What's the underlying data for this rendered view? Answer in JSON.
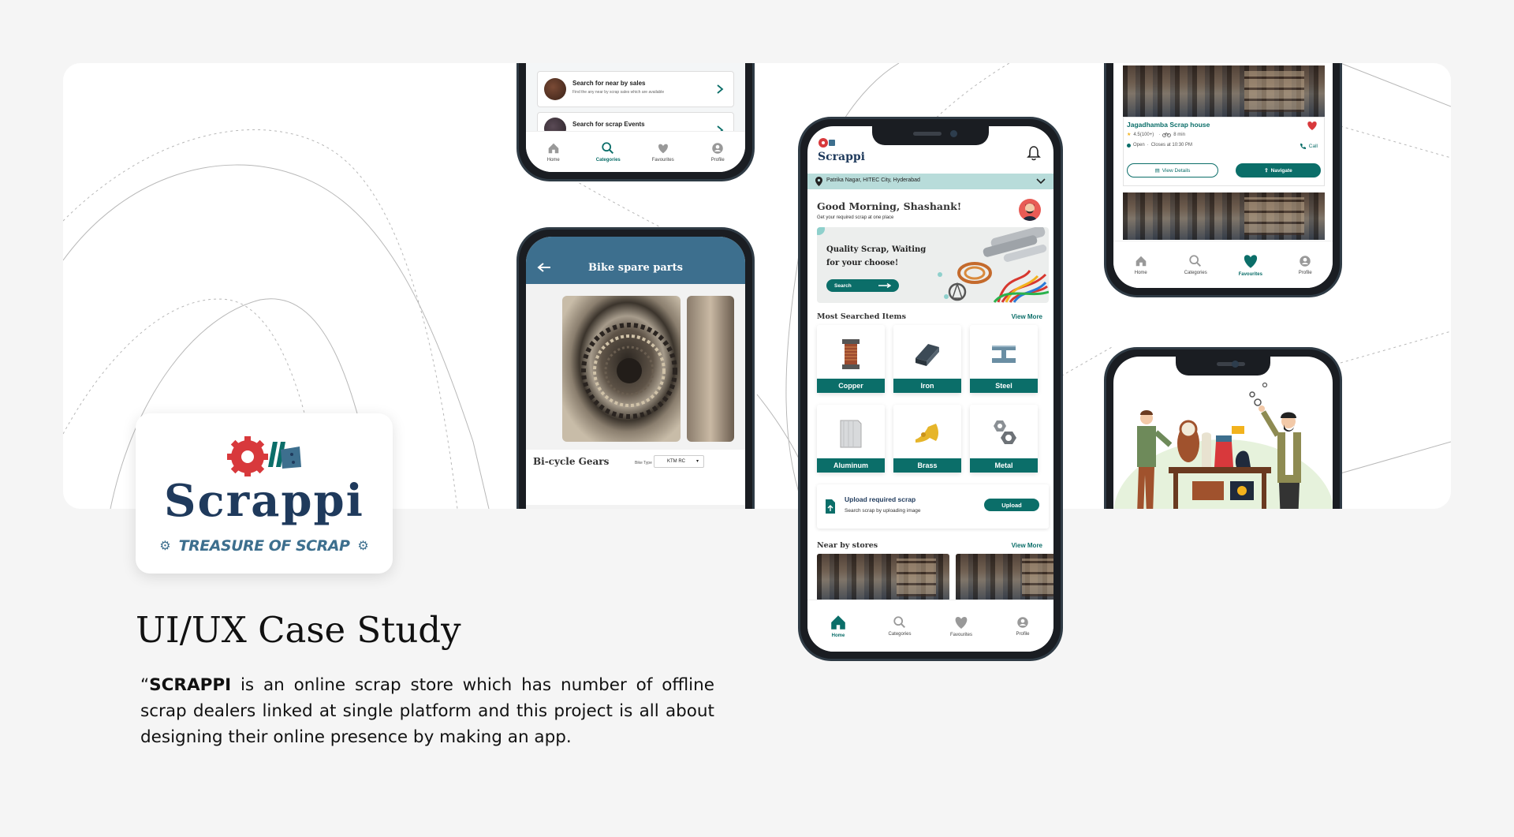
{
  "brand": {
    "name": "Scrappi",
    "tagline": "TREASURE OF SCRAP",
    "colors": {
      "navy": "#1f3a5c",
      "teal": "#0b6e69",
      "red": "#d8393c",
      "steel": "#3d6f8e"
    }
  },
  "case_study": {
    "title": "UI/UX Case Study",
    "quote_mark": "“",
    "strong": "SCRAPPI",
    "desc": " is an online scrap store which has number of offline scrap dealers linked at single platform and this project is all about designing their online presence by making an app."
  },
  "nav": {
    "home": "Home",
    "categories": "Categories",
    "favourites": "Favourites",
    "profile": "Profile"
  },
  "phone_top": {
    "items": [
      {
        "title": "Search for near by sales",
        "sub": "Find the any near by scrap sales which are available"
      },
      {
        "title": "Search for scrap Events",
        "sub": ""
      }
    ]
  },
  "phone_bike": {
    "header": "Bike spare parts",
    "product": "Bi-cycle Gears",
    "filter_label": "Bike Type",
    "filter_value": "KTM RC"
  },
  "phone_main": {
    "logo_text": "Scrappi",
    "location": "Patrika Nagar, HITEC City, Hyderabad",
    "greeting": "Good Morning, Shashank!",
    "greeting_sub": "Get your required scrap at one place",
    "banner_text": "Quality Scrap, Waiting for your choose!",
    "banner_button": "Search",
    "most_searched": "Most Searched Items",
    "view_more": "View More",
    "categories": [
      "Copper",
      "Iron",
      "Steel",
      "Aluminum",
      "Brass",
      "Metal"
    ],
    "upload_title": "Upload required scrap",
    "upload_sub": "Search scrap by uploading image",
    "upload_button": "Upload",
    "near_stores": "Near by stores",
    "view_more_2": "View More"
  },
  "phone_fav": {
    "shop_name": "Jagadhamba Scrap house",
    "rating": "4.5(100+)",
    "distance": "8 min",
    "status": "Open",
    "closes": "Closes at 10:30 PM",
    "call": "Call",
    "view_details": "View Details",
    "navigate": "Navigate"
  }
}
